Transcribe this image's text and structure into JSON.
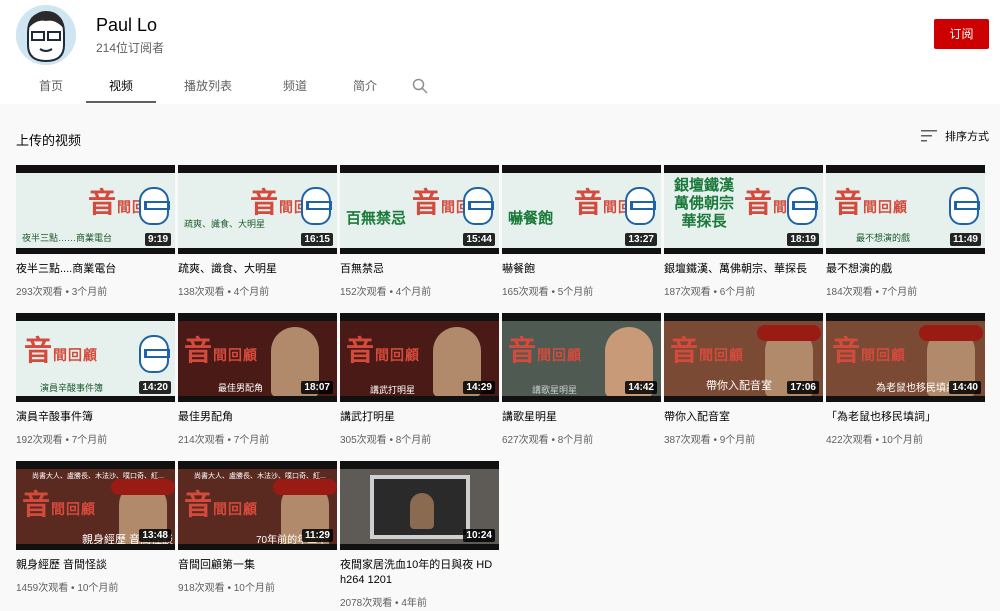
{
  "channel": {
    "name": "Paul Lo",
    "subscribers": "214位订阅者",
    "subscribe_label": "订阅"
  },
  "tabs": [
    {
      "label": "首页"
    },
    {
      "label": "视频"
    },
    {
      "label": "播放列表"
    },
    {
      "label": "频道"
    },
    {
      "label": "简介"
    }
  ],
  "section": {
    "title": "上传的视频",
    "sort_label": "排序方式"
  },
  "thumbnail_text": {
    "stamp_small": "間回顧",
    "stamp_big": "音"
  },
  "videos": [
    {
      "title": "夜半三點....商業電台",
      "views": "293次观看",
      "age": "3个月前",
      "duration": "9:19",
      "caption": "夜半三點……商業電台"
    },
    {
      "title": "疏爽、識食、大明星",
      "views": "138次观看",
      "age": "4个月前",
      "duration": "16:15",
      "caption": "疏爽、識食、大明星"
    },
    {
      "title": "百無禁忌",
      "views": "152次观看",
      "age": "4个月前",
      "duration": "15:44",
      "caption": "百無禁忌"
    },
    {
      "title": "嚇餐飽",
      "views": "165次观看",
      "age": "5个月前",
      "duration": "13:27",
      "caption": "嚇餐飽"
    },
    {
      "title": "銀壇鐵漢、萬佛朝宗、華探長",
      "views": "187次观看",
      "age": "6个月前",
      "duration": "18:19",
      "caption_lines": [
        "銀壇鐵漢",
        "萬佛朝宗",
        "華探長"
      ]
    },
    {
      "title": "最不想演的戲",
      "views": "184次观看",
      "age": "7个月前",
      "duration": "11:49",
      "caption": "最不想演的戲"
    },
    {
      "title": "演員辛酸事件簿",
      "views": "192次观看",
      "age": "7个月前",
      "duration": "14:20",
      "caption": "演員辛酸事件簿"
    },
    {
      "title": "最佳男配角",
      "views": "214次观看",
      "age": "7个月前",
      "duration": "18:07",
      "caption": "最佳男配角"
    },
    {
      "title": "講武打明星",
      "views": "305次观看",
      "age": "8个月前",
      "duration": "14:29",
      "caption": "講武打明星"
    },
    {
      "title": "講歌星明星",
      "views": "627次观看",
      "age": "8个月前",
      "duration": "14:42",
      "caption": "講歌星明星"
    },
    {
      "title": "帶你入配音室",
      "views": "387次观看",
      "age": "9个月前",
      "duration": "17:06",
      "caption": "帶你入配音室"
    },
    {
      "title": "「為老鼠也移民填詞」",
      "views": "422次观看",
      "age": "10个月前",
      "duration": "14:40",
      "caption": "為老鼠也移民填詞"
    },
    {
      "title": "親身經歷 音間怪談",
      "views": "1459次观看",
      "age": "10个月前",
      "duration": "13:48",
      "caption": "親身經歷 音間怪談",
      "top_caption": "尚書大人、盧勝長、木法沙、噗口奇、紅..."
    },
    {
      "title": "音間回顧第一集",
      "views": "918次观看",
      "age": "10个月前",
      "duration": "11:29",
      "caption": "70年前的年三十",
      "top_caption": "尚書大人、盧勝長、木法沙、噗口奇、紅..."
    },
    {
      "title": "夜間家居洗血10年的日與夜 HD h264 1201",
      "views": "2078次观看",
      "age": "4年前",
      "duration": "10:24"
    }
  ]
}
